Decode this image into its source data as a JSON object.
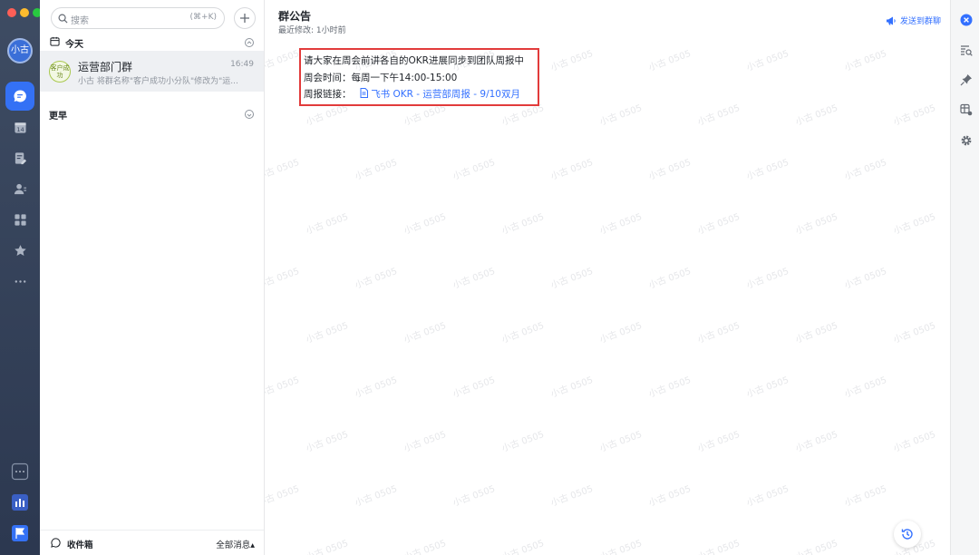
{
  "sidebar": {
    "avatar_text": "小古"
  },
  "chat_list": {
    "search_placeholder": "搜索",
    "search_shortcut": "(⌘+K)",
    "today_label": "今天",
    "earlier_label": "更早",
    "chats": [
      {
        "group_avatar_text": "客户成功",
        "name": "运营部门群",
        "time": "16:49",
        "preview": "小古 将群名称\"客户成功小分队\"修改为\"运..."
      }
    ],
    "inbox_label": "收件箱",
    "filter_label": "全部消息▴"
  },
  "main": {
    "title": "群公告",
    "subtitle": "最近修改: 1小时前",
    "send_label": "发送到群聊",
    "announcement": {
      "line1": "请大家在周会前讲各自的OKR进展同步到团队周报中",
      "line2": "周会时间：每周一下午14:00-15:00",
      "line3_label": "周报链接：",
      "line3_link": "飞书 OKR - 运营部周报 - 9/10双月"
    },
    "watermark": "小古 0505"
  },
  "colors": {
    "accent": "#3370ff",
    "annotation": "#e23b3b",
    "rail": "#34415a"
  }
}
